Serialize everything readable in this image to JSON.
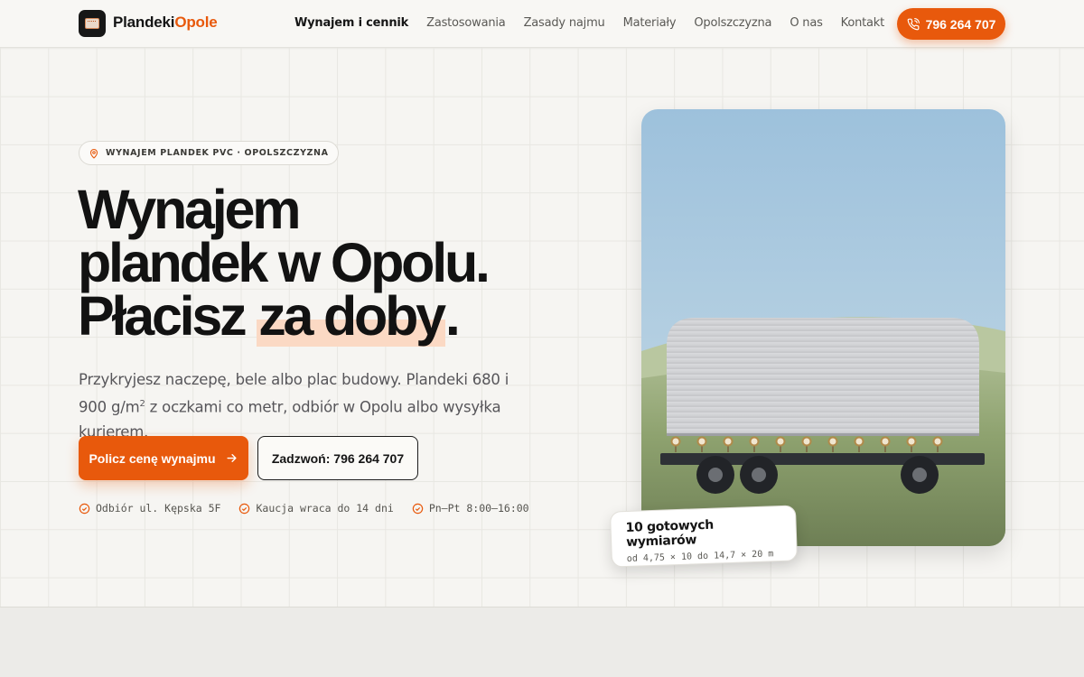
{
  "header": {
    "brand_part1": "Plandeki",
    "brand_part2": "Opole",
    "nav": [
      {
        "label": "Wynajem i cennik"
      },
      {
        "label": "Zastosowania"
      },
      {
        "label": "Zasady najmu"
      },
      {
        "label": "Materiały"
      },
      {
        "label": "Opolszczyzna"
      },
      {
        "label": "O nas"
      },
      {
        "label": "Kontakt"
      }
    ],
    "phone_button": "796 264 707"
  },
  "hero": {
    "badge": "WYNAJEM PLANDEK PVC · OPOLSZCZYZNA",
    "headline_line1": "Wynajem",
    "headline_line2": "plandek w Opolu.",
    "headline_line3_part1": "Płacisz ",
    "headline_line3_highlight": "za doby",
    "headline_line3_part2": ".",
    "sub_part1": "Przykryjesz naczepę, bele albo plac budowy. Plandeki 680 i 900 g/m",
    "sub_sup": "2",
    "sub_part2": " z oczkami co metr, odbiór w Opolu albo wysyłka kurierem.",
    "cta_primary": "Policz cenę wynajmu",
    "cta_secondary": "Zadzwoń: 796 264 707",
    "features": [
      {
        "label": "Odbiór ul. Kępska 5F"
      },
      {
        "label": "Kaucja wraca do 14 dni"
      },
      {
        "label": "Pn–Pt 8:00–16:00"
      }
    ]
  },
  "sizes_card": {
    "title": "10 gotowych wymiarów",
    "subtitle": "od 4,75 × 10 do 14,7 × 20 m"
  },
  "colors": {
    "accent": "#e8590c",
    "highlight": "#fbd9c4",
    "text": "#141414"
  }
}
